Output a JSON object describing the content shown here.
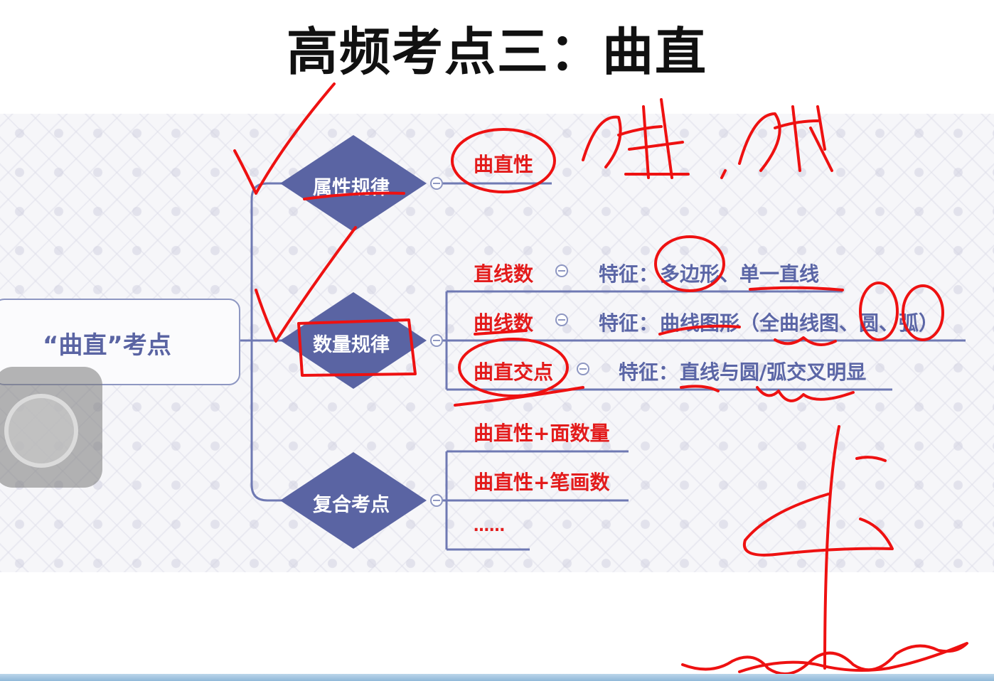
{
  "title": "高频考点三：曲直",
  "mindmap": {
    "root": "“曲直”考点",
    "branches": [
      {
        "label": "属性规律",
        "children": [
          {
            "label": "曲直性"
          }
        ]
      },
      {
        "label": "数量规律",
        "children": [
          {
            "label": "直线数",
            "feature_prefix": "特征：",
            "feature": "多边形、单一直线"
          },
          {
            "label": "曲线数",
            "feature_prefix": "特征：",
            "feature": "曲线图形（全曲线图、圆、弧）"
          },
          {
            "label": "曲直交点",
            "feature_prefix": "特征：",
            "feature": "直线与圆/弧交叉明显"
          }
        ]
      },
      {
        "label": "复合考点",
        "children": [
          {
            "label": "曲直性+面数量"
          },
          {
            "label": "曲直性+笔画数"
          },
          {
            "label": "……"
          }
        ]
      }
    ]
  },
  "colors": {
    "diamond": "#5a64a3",
    "line": "#6f79b3",
    "child_text": "#e31b1b",
    "feature_text": "#5b66a6",
    "annotation": "#ee1111"
  }
}
